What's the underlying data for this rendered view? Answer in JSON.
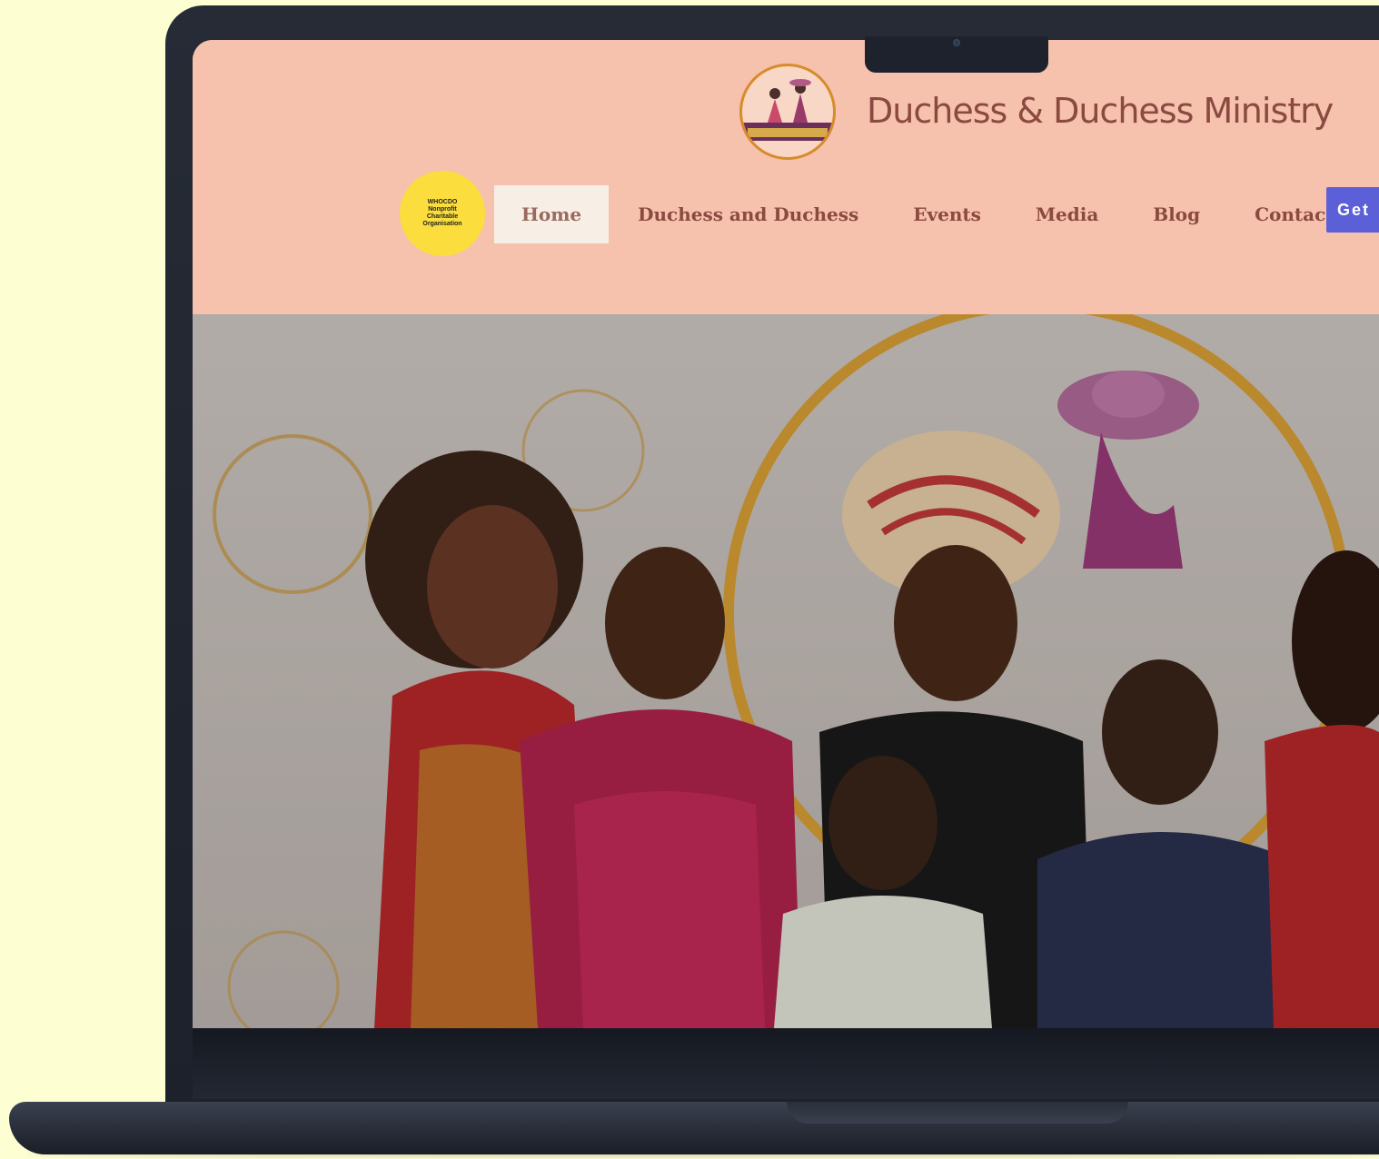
{
  "site": {
    "brand_name": "Duchess & Duchess Ministry",
    "badge_text": "WHOCDO Nonprofit Charitable Organisation"
  },
  "nav": {
    "items": [
      {
        "label": "Home",
        "active": true
      },
      {
        "label": "Duchess and Duchess",
        "active": false
      },
      {
        "label": "Events",
        "active": false
      },
      {
        "label": "Media",
        "active": false
      },
      {
        "label": "Blog",
        "active": false
      },
      {
        "label": "Contact",
        "active": false
      }
    ],
    "cta_label": "Get"
  },
  "hero": {
    "image": "group-photo-of-smiling-women-and-girls"
  },
  "colors": {
    "page_background": "#fdfed2",
    "header_background": "#f6c1ad",
    "nav_text": "#8a4a40",
    "active_nav_background": "#f7efe6",
    "cta_background": "#5b5fd8",
    "badge_background": "#fbde3d",
    "device": "#1f232c"
  }
}
